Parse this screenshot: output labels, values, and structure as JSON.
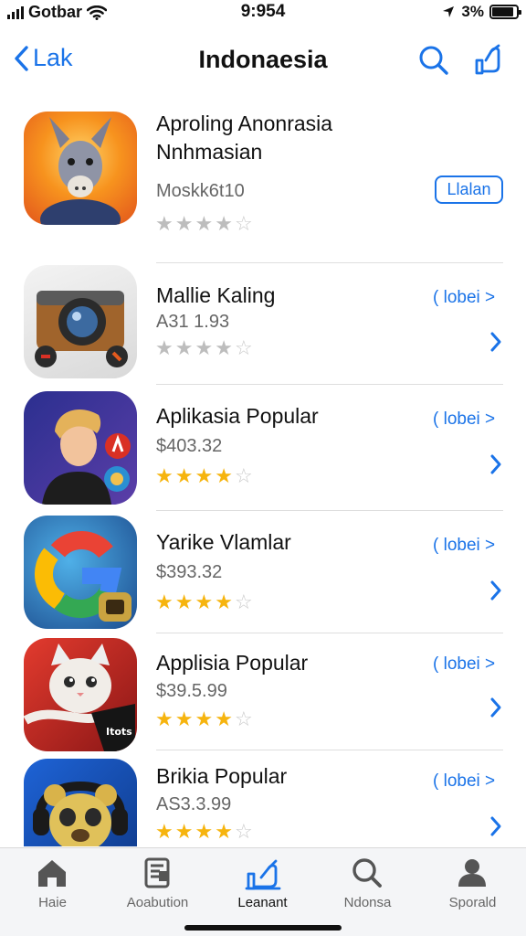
{
  "status_bar": {
    "carrier": "Gotbar",
    "time": "9:954",
    "battery_text": "3%",
    "battery_level": 0.9
  },
  "nav": {
    "back_label": "Lak",
    "title": "Indonaesia",
    "search_icon": "search-icon",
    "share_icon": "share-icon"
  },
  "apps": [
    {
      "name": "Aproling Anonrasia Nnhmasian",
      "price": "Moskk6t10",
      "rating": 4,
      "star_style": "grey",
      "button_label": "Llalan",
      "icon": "donkey-app-icon"
    },
    {
      "name": "Mallie Kaling",
      "price": "A31 1.93",
      "rating": 4,
      "star_style": "grey",
      "link_label": "( lobei >",
      "icon": "camera-app-icon"
    },
    {
      "name": "Aplikasia Popular",
      "price": "$403.32",
      "rating": 4,
      "star_style": "gold",
      "link_label": "( lobei >",
      "icon": "person-app-icon"
    },
    {
      "name": "Yarike Vlamlar",
      "price": "$393.32",
      "rating": 4,
      "star_style": "gold",
      "link_label": "( lobei >",
      "icon": "g-app-icon"
    },
    {
      "name": "Applisia Popular",
      "price": "$39.5.99",
      "rating": 4,
      "star_style": "gold",
      "link_label": "( lobei >",
      "icon": "cat-app-icon",
      "icon_badge": "Itots"
    },
    {
      "name": "Brikia Popular",
      "price": "AS3.3.99",
      "rating": 4,
      "star_style": "gold",
      "link_label": "( lobei >",
      "icon": "bear-app-icon"
    }
  ],
  "tabs": [
    {
      "label": "Haie",
      "icon": "home-icon"
    },
    {
      "label": "Aoabution",
      "icon": "document-icon"
    },
    {
      "label": "Leanant",
      "icon": "apps-icon",
      "active": true
    },
    {
      "label": "Ndonsa",
      "icon": "search-icon"
    },
    {
      "label": "Sporald",
      "icon": "person-icon"
    }
  ],
  "colors": {
    "accent": "#1a73e8",
    "star": "#f6b40e"
  }
}
